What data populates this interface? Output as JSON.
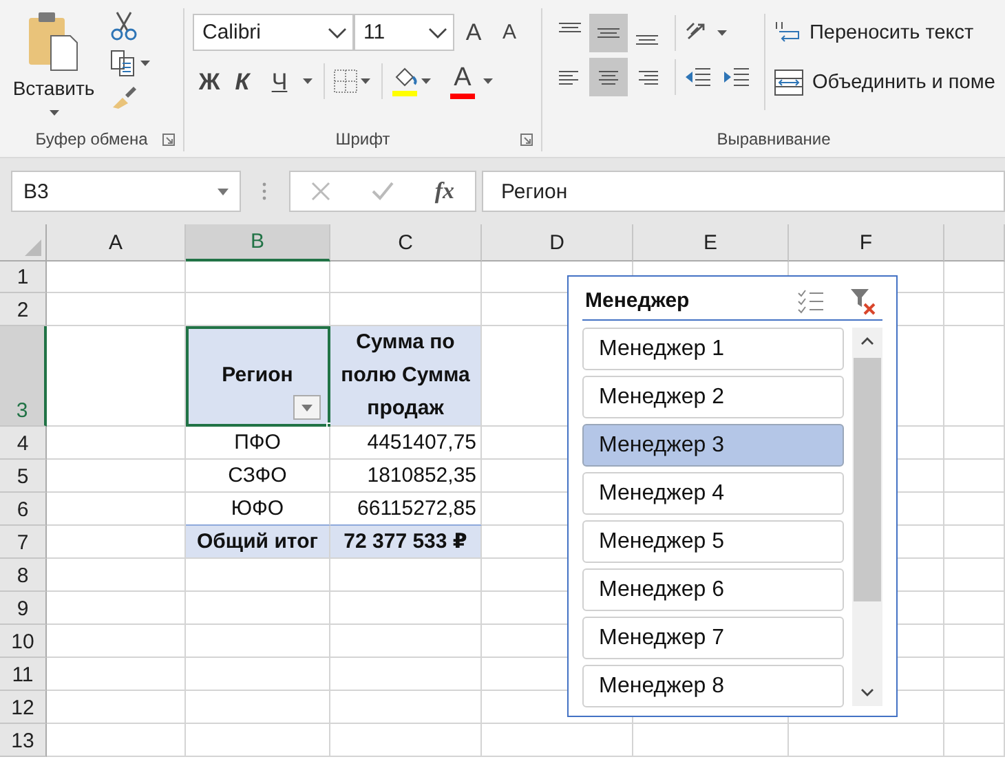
{
  "ribbon": {
    "clipboard": {
      "paste_label": "Вставить",
      "group_label": "Буфер обмена"
    },
    "font": {
      "font_name": "Calibri",
      "font_size": "11",
      "grow_glyph": "A",
      "shrink_glyph": "A",
      "bold": "Ж",
      "italic": "К",
      "underline": "Ч",
      "font_color_glyph": "A",
      "group_label": "Шрифт"
    },
    "alignment": {
      "vertical": [
        {
          "kind": "top",
          "selected": false
        },
        {
          "kind": "middle",
          "selected": true
        },
        {
          "kind": "bottom",
          "selected": false
        }
      ],
      "horizontal": [
        {
          "kind": "left",
          "selected": false
        },
        {
          "kind": "center",
          "selected": true
        },
        {
          "kind": "right",
          "selected": false
        }
      ],
      "wrap_text": "Переносить текст",
      "merge": "Объединить и поме",
      "group_label": "Выравнивание"
    }
  },
  "formula_bar": {
    "name_box": "B3",
    "function_glyph": "fx",
    "formula": "Регион"
  },
  "sheet": {
    "columns": [
      {
        "label": "A",
        "selected": false
      },
      {
        "label": "B",
        "selected": true
      },
      {
        "label": "C",
        "selected": false
      },
      {
        "label": "D",
        "selected": false
      },
      {
        "label": "E",
        "selected": false
      },
      {
        "label": "F",
        "selected": false
      }
    ],
    "rows": [
      {
        "label": "1",
        "selected": false
      },
      {
        "label": "2",
        "selected": false
      },
      {
        "label": "3",
        "selected": true
      },
      {
        "label": "4",
        "selected": false
      },
      {
        "label": "5",
        "selected": false
      },
      {
        "label": "6",
        "selected": false
      },
      {
        "label": "7",
        "selected": false
      },
      {
        "label": "8",
        "selected": false
      },
      {
        "label": "9",
        "selected": false
      },
      {
        "label": "10",
        "selected": false
      },
      {
        "label": "11",
        "selected": false
      },
      {
        "label": "12",
        "selected": false
      },
      {
        "label": "13",
        "selected": false
      }
    ],
    "pivot": {
      "header": {
        "region": "Регион",
        "sum": "Сумма по полю Сумма продаж"
      },
      "rows": [
        {
          "region": "ПФО",
          "value": "4451407,75"
        },
        {
          "region": "СЗФО",
          "value": "1810852,35"
        },
        {
          "region": "ЮФО",
          "value": "66115272,85"
        }
      ],
      "total": {
        "label": "Общий итог",
        "value": "72 377 533 ₽"
      }
    }
  },
  "slicer": {
    "title": "Менеджер",
    "items": [
      {
        "label": "Менеджер 1",
        "selected": false
      },
      {
        "label": "Менеджер 2",
        "selected": false
      },
      {
        "label": "Менеджер 3",
        "selected": true
      },
      {
        "label": "Менеджер 4",
        "selected": false
      },
      {
        "label": "Менеджер 5",
        "selected": false
      },
      {
        "label": "Менеджер 6",
        "selected": false
      },
      {
        "label": "Менеджер 7",
        "selected": false
      },
      {
        "label": "Менеджер 8",
        "selected": false
      }
    ]
  }
}
